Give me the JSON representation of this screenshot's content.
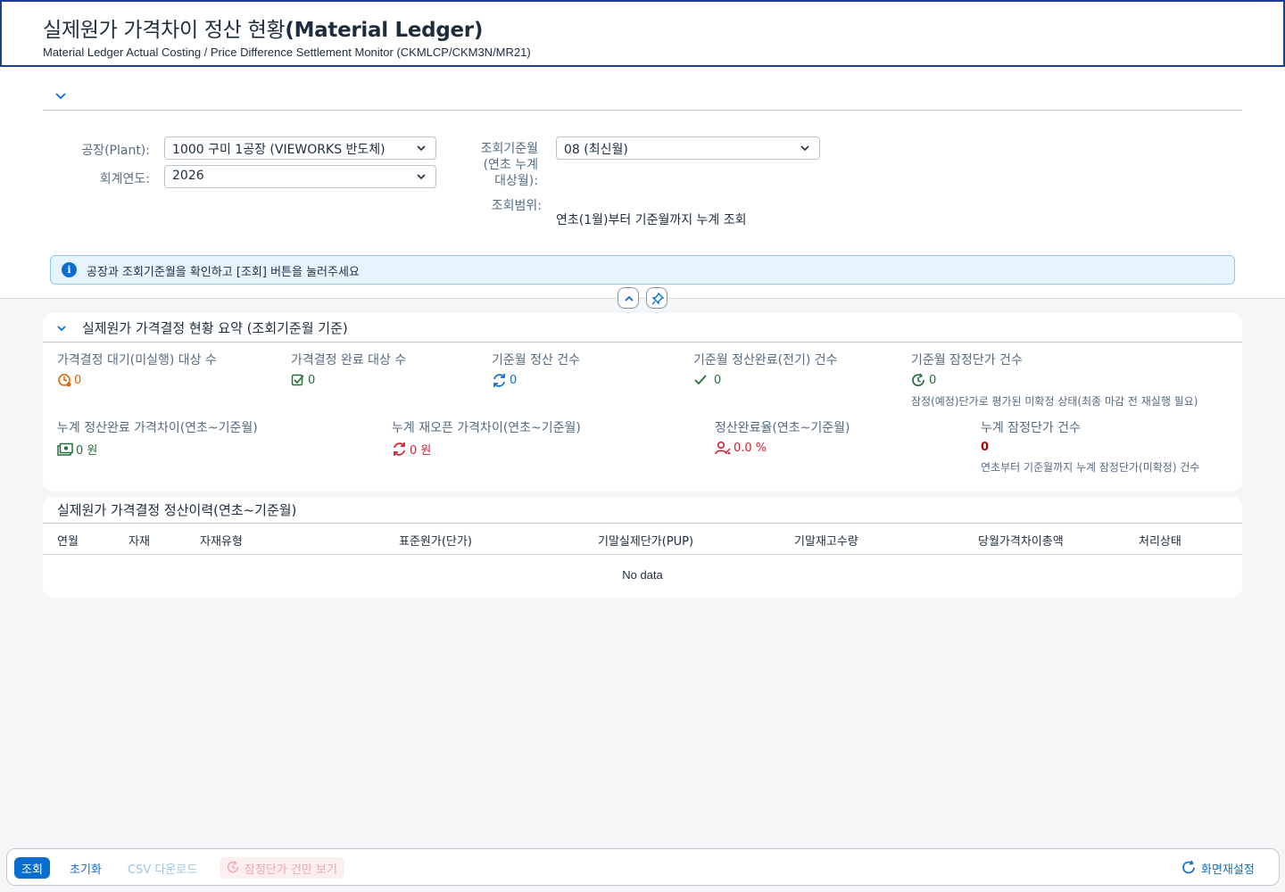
{
  "header": {
    "title_ko": "실제원가 가격차이 정산 현황",
    "title_en": "(Material Ledger)",
    "subtitle": "Material Ledger Actual Costing / Price Difference Settlement Monitor (CKMLCP/CKM3N/MR21)"
  },
  "filters": {
    "plant_label": "공장(Plant):",
    "plant_value": "1000 구미 1공장 (VIEWORKS 반도체)",
    "year_label": "회계연도:",
    "year_value": "2026",
    "period_label_1": "조회기준월",
    "period_label_2": "(연초 누계",
    "period_label_3": "대상월):",
    "period_value": "08 (최신월)",
    "range_label": "조회범위:",
    "range_value": "연초(1월)부터 기준월까지 누계 조회"
  },
  "info_message": "공장과 조회기준월을 확인하고 [조회] 버튼을 눌러주세요",
  "summary": {
    "title": "실제원가 가격결정 현황 요약 (조회기준월 기준)",
    "kpis": [
      {
        "label": "가격결정 대기(미실행) 대상 수",
        "value": "0",
        "icon": "pending-clock-icon",
        "color": "#e76500"
      },
      {
        "label": "가격결정 완료 대상 수",
        "value": "0",
        "icon": "checkbox-icon",
        "color": "#256f3a"
      },
      {
        "label": "기준월 정산 건수",
        "value": "0",
        "icon": "sync-icon",
        "color": "#0a6ed1"
      },
      {
        "label": "기준월 정산완료(전기) 건수",
        "value": "0",
        "icon": "checkmark-icon",
        "color": "#256f3a"
      },
      {
        "label": "기준월 잠정단가 건수",
        "value": "0",
        "icon": "refresh-clock-icon",
        "color": "#256f3a",
        "note": "잠정(예정)단가로 평가된 미확정 상태(최종 마감 전 재실행 필요)"
      },
      {
        "label": "누계 정산완료 가격차이(연초~기준월)",
        "value": "0 원",
        "icon": "money-bills-icon",
        "color": "#256f3a"
      },
      {
        "label": "누계 재오픈 가격차이(연초~기준월)",
        "value": "0 원",
        "icon": "reopen-sync-icon",
        "color": "#d32030"
      },
      {
        "label": "정산완료율(연초~기준월)",
        "value": "0.0 %",
        "icon": "user-rate-icon",
        "color": "#d32030"
      },
      {
        "label": "누계 잠정단가 건수",
        "value": "0",
        "color": "#aa0808",
        "note": "연초부터 기준월까지 누계 잠정단가(미확정) 건수"
      }
    ]
  },
  "history": {
    "title": "실제원가 가격결정 정산이력(연초~기준월)",
    "columns": [
      "연월",
      "자재",
      "자재유형",
      "표준원가(단가)",
      "기말실제단가(PUP)",
      "기말재고수량",
      "당월가격차이총액",
      "처리상태"
    ],
    "empty_text": "No data"
  },
  "footer": {
    "search": "조회",
    "reset": "초기화",
    "csv": "CSV 다운로드",
    "provisional_only": "잠정단가 건만 보기",
    "screen_reset": "화면재설정"
  }
}
